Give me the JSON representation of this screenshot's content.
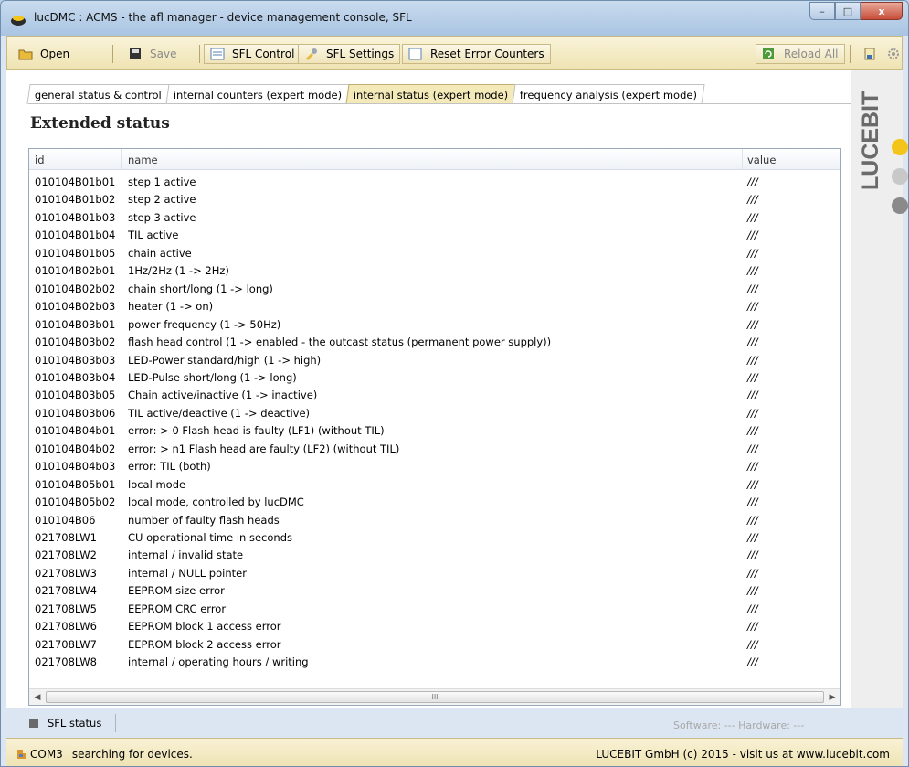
{
  "window": {
    "title": "lucDMC : ACMS - the afl manager - device management console, SFL"
  },
  "toolbar": {
    "open": "Open",
    "save": "Save",
    "sfl_control": "SFL Control",
    "sfl_settings": "SFL Settings",
    "reset_error_counters": "Reset Error Counters",
    "reload_all": "Reload All"
  },
  "brand": {
    "logo_text": "LUCEBIT",
    "dot_colors": [
      "#f3c51b",
      "#c8c8c8",
      "#8a8a8a"
    ]
  },
  "tabs": [
    {
      "label": "general status & control"
    },
    {
      "label": "internal counters  (expert mode)"
    },
    {
      "label": "internal status (expert mode)"
    },
    {
      "label": "frequency analysis (expert mode)"
    }
  ],
  "heading": "Extended status",
  "table": {
    "columns": {
      "id": "id",
      "name": "name",
      "value": "value"
    },
    "rows": [
      {
        "id": "010104B01b01",
        "name": "step 1 active",
        "value": "///"
      },
      {
        "id": "010104B01b02",
        "name": "step 2 active",
        "value": "///"
      },
      {
        "id": "010104B01b03",
        "name": "step 3 active",
        "value": "///"
      },
      {
        "id": "010104B01b04",
        "name": "TIL active",
        "value": "///"
      },
      {
        "id": "010104B01b05",
        "name": "chain active",
        "value": "///"
      },
      {
        "id": "010104B02b01",
        "name": "1Hz/2Hz (1 -> 2Hz)",
        "value": "///"
      },
      {
        "id": "010104B02b02",
        "name": "chain short/long (1 -> long)",
        "value": "///"
      },
      {
        "id": "010104B02b03",
        "name": "heater (1 -> on)",
        "value": "///"
      },
      {
        "id": "010104B03b01",
        "name": "power frequency (1 -> 50Hz)",
        "value": "///"
      },
      {
        "id": "010104B03b02",
        "name": "flash head control (1 -> enabled - the outcast status (permanent power supply))",
        "value": "///"
      },
      {
        "id": "010104B03b03",
        "name": "LED-Power standard/high (1 -> high)",
        "value": "///"
      },
      {
        "id": "010104B03b04",
        "name": "LED-Pulse short/long (1 -> long)",
        "value": "///"
      },
      {
        "id": "010104B03b05",
        "name": "Chain active/inactive (1 -> inactive)",
        "value": "///"
      },
      {
        "id": "010104B03b06",
        "name": "TIL active/deactive (1 -> deactive)",
        "value": "///"
      },
      {
        "id": "010104B04b01",
        "name": "error: > 0  Flash head is faulty  (LF1) (without TIL)",
        "value": "///"
      },
      {
        "id": "010104B04b02",
        "name": "error: > n1 Flash head are faulty (LF2) (without TIL)",
        "value": "///"
      },
      {
        "id": "010104B04b03",
        "name": "error: TIL (both)",
        "value": "///"
      },
      {
        "id": "010104B05b01",
        "name": "local mode",
        "value": "///"
      },
      {
        "id": "010104B05b02",
        "name": "local mode, controlled by lucDMC",
        "value": "///"
      },
      {
        "id": "010104B06",
        "name": "number of faulty flash heads",
        "value": "///"
      },
      {
        "id": "021708LW1",
        "name": "CU operational time in seconds",
        "value": "///"
      },
      {
        "id": "021708LW2",
        "name": "internal / invalid state",
        "value": "///"
      },
      {
        "id": "021708LW3",
        "name": "internal / NULL pointer",
        "value": "///"
      },
      {
        "id": "021708LW4",
        "name": "EEPROM size error",
        "value": "///"
      },
      {
        "id": "021708LW5",
        "name": "EEPROM CRC error",
        "value": "///"
      },
      {
        "id": "021708LW6",
        "name": "EEPROM block 1 access error",
        "value": "///"
      },
      {
        "id": "021708LW7",
        "name": "EEPROM block 2 access error",
        "value": "///"
      },
      {
        "id": "021708LW8",
        "name": "internal / operating hours / writing",
        "value": "///"
      }
    ]
  },
  "scrollbar": {
    "thumb_grip": "III"
  },
  "panel": {
    "sfl_status": "SFL status",
    "software_hardware": "Software:  ---  Hardware:  ---"
  },
  "statusbar": {
    "port": "COM3",
    "message": "searching for devices.",
    "copyright": "LUCEBIT GmbH (c) 2015 - visit us at www.lucebit.com"
  }
}
